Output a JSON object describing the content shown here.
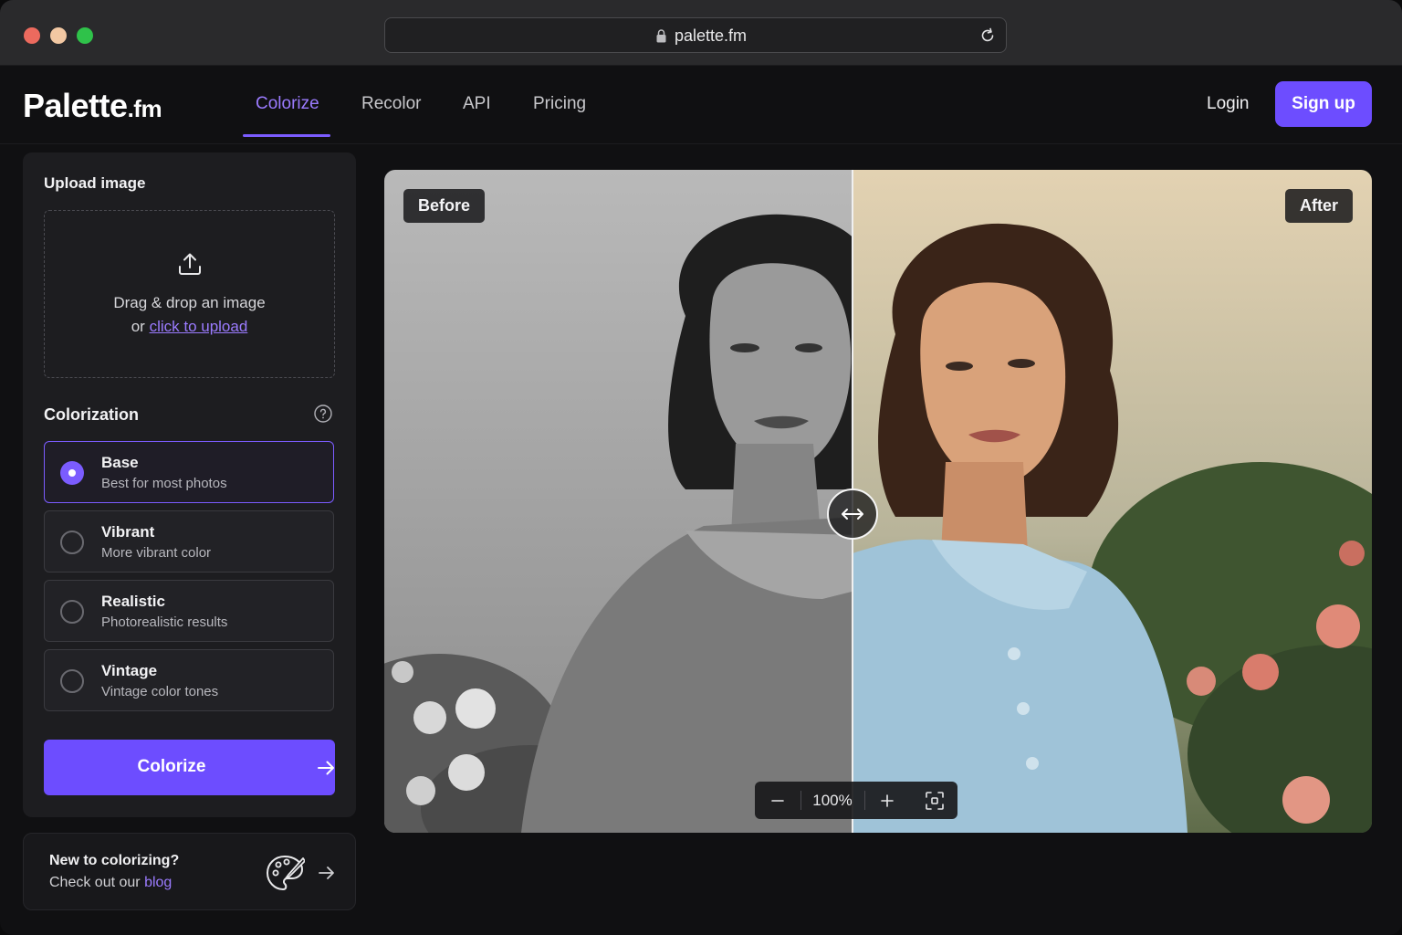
{
  "browser": {
    "url": "palette.fm",
    "icons": [
      "lock-icon",
      "reload-icon"
    ]
  },
  "header": {
    "logo_main": "Palette",
    "logo_suffix": ".fm",
    "nav": [
      {
        "label": "Colorize",
        "active": true
      },
      {
        "label": "Recolor",
        "active": false
      },
      {
        "label": "API",
        "active": false
      },
      {
        "label": "Pricing",
        "active": false
      }
    ],
    "login_label": "Login",
    "signup_label": "Sign up"
  },
  "upload": {
    "title": "Upload image",
    "drop_text": "Drag & drop an image",
    "or_text": "or",
    "link_text": "click to upload"
  },
  "colorization": {
    "title": "Colorization",
    "options": [
      {
        "title": "Base",
        "subtitle": "Best for most photos",
        "selected": true
      },
      {
        "title": "Vibrant",
        "subtitle": "More vibrant color",
        "selected": false
      },
      {
        "title": "Realistic",
        "subtitle": "Photorealistic results",
        "selected": false
      },
      {
        "title": "Vintage",
        "subtitle": "Vintage color tones",
        "selected": false
      }
    ],
    "button_label": "Colorize"
  },
  "blog_card": {
    "question": "New to colorizing?",
    "line_prefix": "Check out our",
    "link_text": "blog"
  },
  "viewer": {
    "before_label": "Before",
    "after_label": "After",
    "zoom": "100%"
  },
  "colors": {
    "accent": "#6d4dff",
    "accent_text": "#9b7bff",
    "background": "#101012",
    "panel": "#1d1d20"
  }
}
